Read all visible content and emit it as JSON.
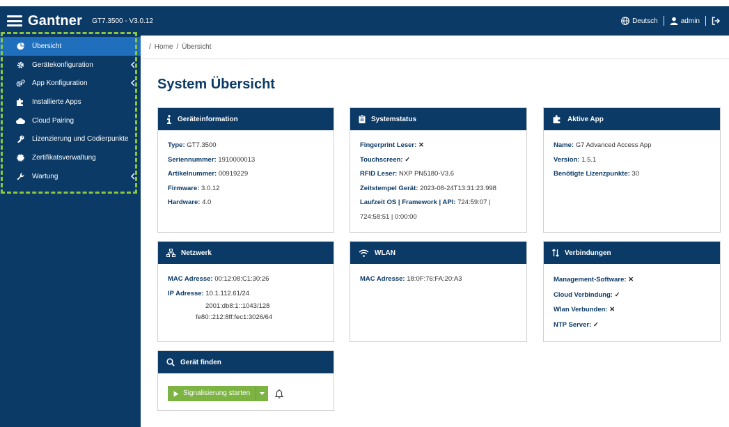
{
  "topbar": {
    "brand": "Gantner",
    "version": "GT7.3500 - V3.0.12",
    "language": "Deutsch",
    "user": "admin"
  },
  "sidebar": {
    "items": [
      {
        "label": "Übersicht",
        "icon": "dashboard-icon",
        "active": true
      },
      {
        "label": "Gerätekonfiguration",
        "icon": "gear-icon",
        "expandable": true
      },
      {
        "label": "App Konfiguration",
        "icon": "gears-icon",
        "expandable": true
      },
      {
        "label": "Installierte Apps",
        "icon": "puzzle-icon"
      },
      {
        "label": "Cloud Pairing",
        "icon": "cloud-icon"
      },
      {
        "label": "Lizenzierung und Codierpunkte",
        "icon": "key-icon"
      },
      {
        "label": "Zertifikatsverwaltung",
        "icon": "certificate-icon"
      },
      {
        "label": "Wartung",
        "icon": "wrench-icon",
        "expandable": true
      }
    ]
  },
  "breadcrumb": {
    "sep": "/",
    "home": "Home",
    "current": "Übersicht"
  },
  "page": {
    "title": "System Übersicht"
  },
  "cards": {
    "device": {
      "title": "Geräteinformation",
      "type_label": "Type:",
      "type_value": "GT7.3500",
      "serial_label": "Seriennummer:",
      "serial_value": "1910000013",
      "article_label": "Artikelnummer:",
      "article_value": "00919229",
      "firmware_label": "Firmware:",
      "firmware_value": "3.0.12",
      "hardware_label": "Hardware:",
      "hardware_value": "4.0"
    },
    "system": {
      "title": "Systemstatus",
      "fingerprint_label": "Fingerprint Leser:",
      "fingerprint_value": "✕",
      "touch_label": "Touchscreen:",
      "touch_value": "✓",
      "rfid_label": "RFID Leser:",
      "rfid_value": "NXP PN5180-V3.6",
      "timestamp_label": "Zeitstempel Gerät:",
      "timestamp_value": "2023-08-24T13:31:23.998",
      "runtime_label": "Laufzeit OS | Framework | API:",
      "runtime_value_1": "724:59:07 |",
      "runtime_value_2": "724:58:51 | 0:00:00"
    },
    "app": {
      "title": "Aktive App",
      "name_label": "Name:",
      "name_value": "G7 Advanced Access App",
      "version_label": "Version:",
      "version_value": "1.5.1",
      "license_label": "Benötigte Lizenzpunkte:",
      "license_value": "30"
    },
    "network": {
      "title": "Netzwerk",
      "mac_label": "MAC Adresse:",
      "mac_value": "00:12:08:C1:30:26",
      "ip_label": "IP Adresse:",
      "ip_value_1": "10.1.112.61/24",
      "ip_value_2": "2001:db8:1::1043/128",
      "ip_value_3": "fe80::212:8ff:fec1:3026/64"
    },
    "wlan": {
      "title": "WLAN",
      "mac_label": "MAC Adresse:",
      "mac_value": "18:0F:76:FA:20:A3"
    },
    "connections": {
      "title": "Verbindungen",
      "mgmt_label": "Management-Software:",
      "mgmt_value": "✕",
      "cloud_label": "Cloud Verbindung:",
      "cloud_value": "✓",
      "wlan_label": "Wlan Verbunden:",
      "wlan_value": "✕",
      "ntp_label": "NTP Server:",
      "ntp_value": "✓"
    },
    "find": {
      "title": "Gerät finden",
      "button_label": "Signalisierung starten"
    }
  },
  "colors": {
    "primary": "#0b3a66",
    "active": "#1f6fbd",
    "button": "#7cb342",
    "highlight": "#8cc63f"
  }
}
